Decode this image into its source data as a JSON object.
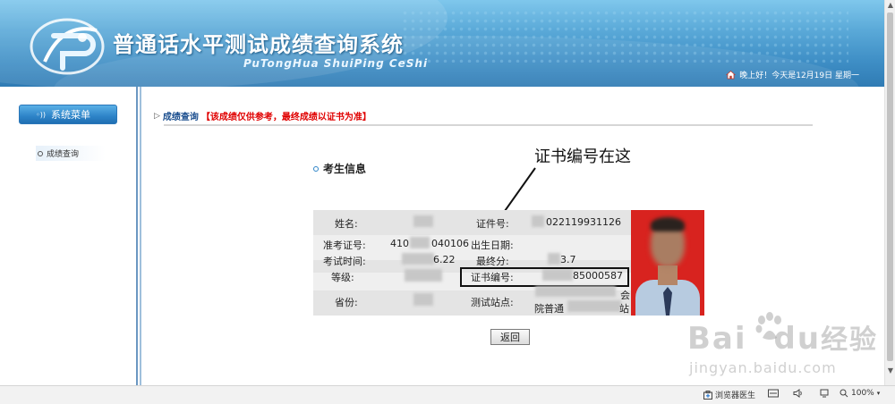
{
  "header": {
    "title": "普通话水平测试成绩查询系统",
    "subtitle": "PuTongHua ShuiPing CeShi",
    "greeting": "晚上好！今天是12月19日 星期一"
  },
  "sidebar": {
    "menu_button": "系统菜单",
    "items": [
      {
        "label": "成绩查询"
      }
    ]
  },
  "breadcrumb": {
    "label": "成绩查询",
    "note": "【该成绩仅供参考，最终成绩以证书为准】"
  },
  "section": {
    "title": "考生信息"
  },
  "annotation": "证书编号在这",
  "info": {
    "name_label": "姓名:",
    "cert_id_label": "证件号:",
    "cert_id_value": "022119931126",
    "ticket_label": "准考证号:",
    "ticket_value_a": "410",
    "ticket_value_b": "040106",
    "birth_label": "出生日期:",
    "exam_time_label": "考试时间:",
    "exam_time_value": "6.22",
    "final_score_label": "最终分:",
    "final_score_value": "3.7",
    "grade_label": "等级:",
    "cert_no_label": "证书编号:",
    "cert_no_value": "85000587",
    "province_label": "省份:",
    "site_label": "测试站点:",
    "site_value_a": "院普通",
    "site_value_b": "站",
    "site_value_c": "会"
  },
  "buttons": {
    "back": "返回"
  },
  "watermark": {
    "brand_a": "Bai",
    "brand_b": "du",
    "brand_cn": "经验",
    "url": "jingyan.baidu.com"
  },
  "statusbar": {
    "doctor": "浏览器医生",
    "zoom": "100%"
  },
  "colors": {
    "header_blue": "#3f8fc6",
    "menu_blue": "#2e84c8",
    "note_red": "#e00000",
    "photo_red": "#d8231f"
  }
}
